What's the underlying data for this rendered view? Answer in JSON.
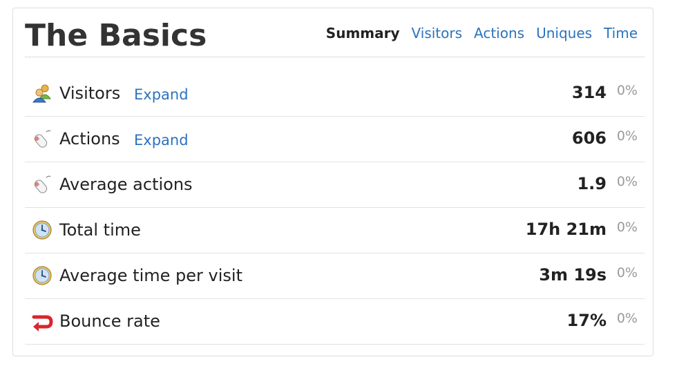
{
  "header": {
    "title": "The Basics",
    "tabs": [
      {
        "label": "Summary",
        "active": true
      },
      {
        "label": "Visitors",
        "active": false
      },
      {
        "label": "Actions",
        "active": false
      },
      {
        "label": "Uniques",
        "active": false
      },
      {
        "label": "Time",
        "active": false
      }
    ]
  },
  "rows": [
    {
      "icon": "visitors-icon",
      "label": "Visitors",
      "expand": "Expand",
      "value": "314",
      "change": "0%"
    },
    {
      "icon": "mouse-icon",
      "label": "Actions",
      "expand": "Expand",
      "value": "606",
      "change": "0%"
    },
    {
      "icon": "mouse-icon",
      "label": "Average actions",
      "value": "1.9",
      "change": "0%"
    },
    {
      "icon": "clock-icon",
      "label": "Total time",
      "value": "17h 21m",
      "change": "0%"
    },
    {
      "icon": "clock-icon",
      "label": "Average time per visit",
      "value": "3m 19s",
      "change": "0%"
    },
    {
      "icon": "bounce-arrow-icon",
      "label": "Bounce rate",
      "value": "17%",
      "change": "0%"
    }
  ],
  "colors": {
    "link": "#2b72be",
    "text": "#222222",
    "muted": "#999999",
    "bounce": "#d9262b"
  }
}
